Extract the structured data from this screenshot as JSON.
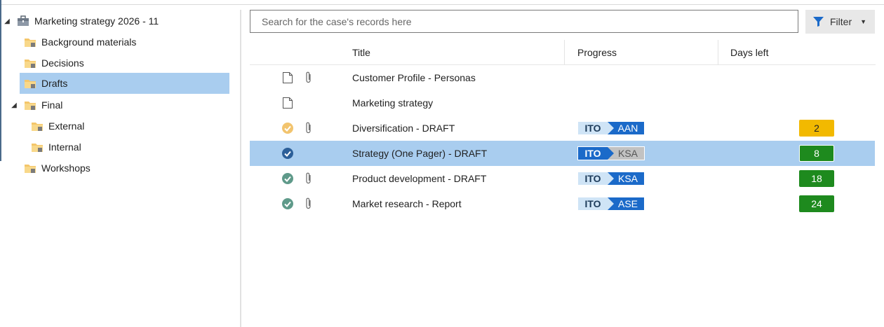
{
  "tree": {
    "root": {
      "label": "Marketing strategy 2026 - 11",
      "expanded": true
    },
    "items": [
      {
        "label": "Background materials",
        "selected": false
      },
      {
        "label": "Decisions",
        "selected": false
      },
      {
        "label": "Drafts",
        "selected": true
      },
      {
        "label": "Final",
        "expanded": true
      },
      {
        "label": "External",
        "selected": false
      },
      {
        "label": "Internal",
        "selected": false
      },
      {
        "label": "Workshops",
        "selected": false
      }
    ]
  },
  "search": {
    "placeholder": "Search for the case's records here",
    "value": ""
  },
  "filter": {
    "label": "Filter",
    "icon": "funnel-icon"
  },
  "grid": {
    "columns": {
      "title": "Title",
      "progress": "Progress",
      "days_left": "Days left"
    },
    "rows": [
      {
        "status": "document",
        "attachment": true,
        "title": "Customer Profile - Personas",
        "progress": null,
        "days": null
      },
      {
        "status": "document",
        "attachment": false,
        "title": "Marketing strategy",
        "progress": null,
        "days": null
      },
      {
        "status": "pending",
        "attachment": true,
        "title": "Diversification - DRAFT",
        "progress": {
          "from": "ITO",
          "to": "AAN",
          "from_active": false,
          "to_active": true
        },
        "days": "2",
        "days_color": "#f2b900"
      },
      {
        "status": "done-selected",
        "attachment": false,
        "title": "Strategy (One Pager) - DRAFT",
        "progress": {
          "from": "ITO",
          "to": "KSA",
          "from_active": true,
          "to_active": false
        },
        "days": "8",
        "days_color": "#1e8a1e",
        "selected": true
      },
      {
        "status": "done",
        "attachment": true,
        "title": "Product development - DRAFT",
        "progress": {
          "from": "ITO",
          "to": "KSA",
          "from_active": false,
          "to_active": true
        },
        "days": "18",
        "days_color": "#1e8a1e"
      },
      {
        "status": "done",
        "attachment": true,
        "title": "Market research - Report",
        "progress": {
          "from": "ITO",
          "to": "ASE",
          "from_active": false,
          "to_active": true
        },
        "days": "24",
        "days_color": "#1e8a1e"
      }
    ]
  },
  "colors": {
    "selection": "#a9cdef",
    "accent_blue": "#1b6ac9",
    "light_blue": "#cfe4f6",
    "amber": "#f2b900",
    "green": "#1e8a1e"
  }
}
